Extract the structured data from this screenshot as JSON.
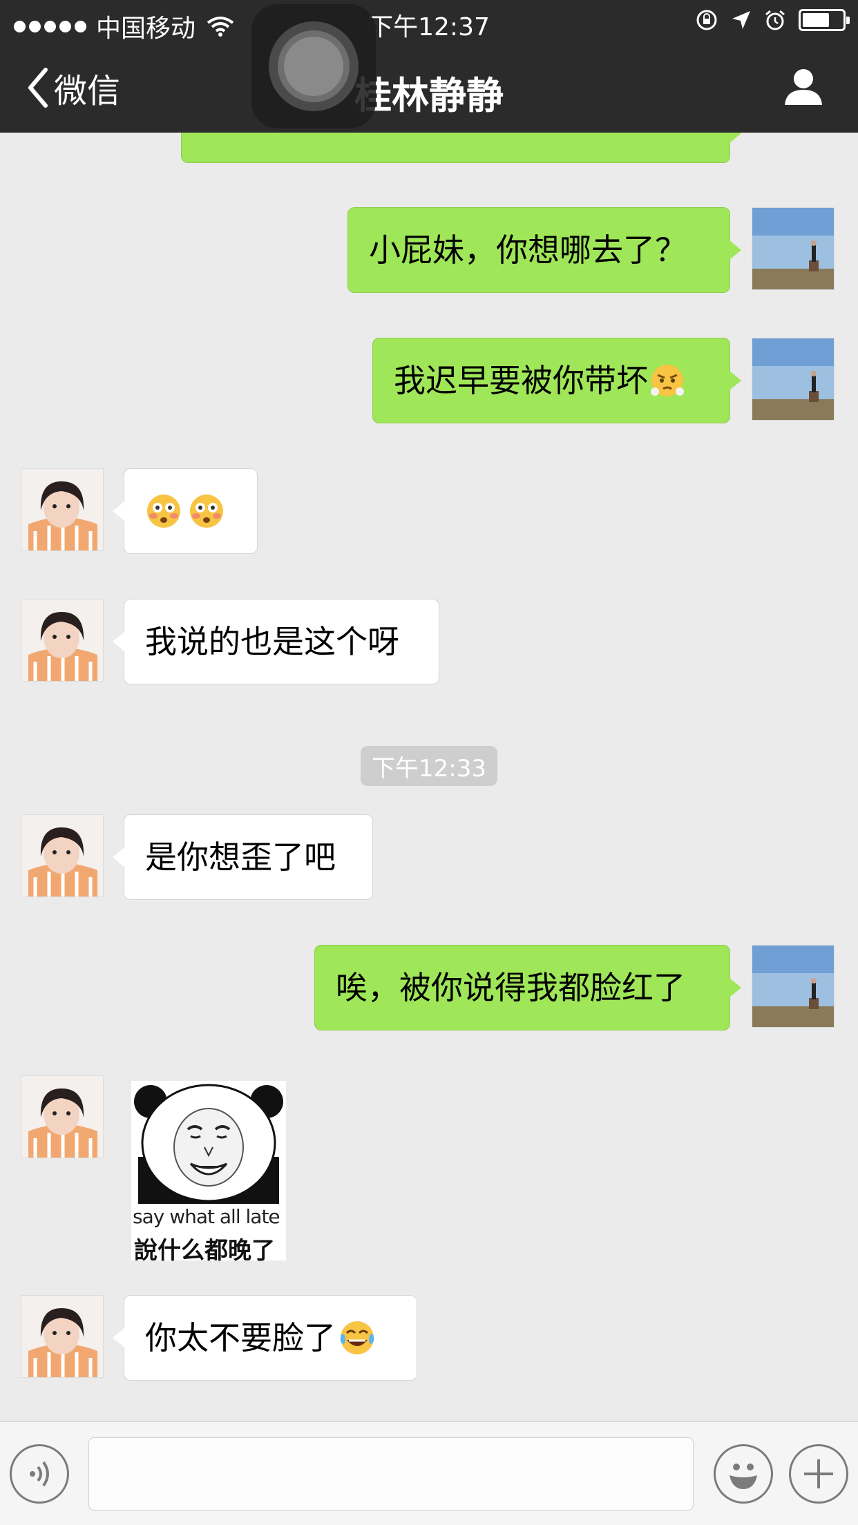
{
  "status_bar": {
    "carrier": "中国移动",
    "time": "下午12:37"
  },
  "nav": {
    "back_label": "微信",
    "title": "桂林静静"
  },
  "messages": [
    {
      "id": "m1",
      "side": "out",
      "text": "小屁妹，你想哪去了？"
    },
    {
      "id": "m2",
      "side": "out",
      "text": "我迟早要被你带坏",
      "emoji": "face-with-steam-from-nose"
    },
    {
      "id": "m3",
      "side": "in",
      "emojis": [
        "flushed-face",
        "flushed-face"
      ]
    },
    {
      "id": "m4",
      "side": "in",
      "text": "我说的也是这个呀"
    },
    {
      "id": "m5",
      "side": "in",
      "text": "是你想歪了吧"
    },
    {
      "id": "m6",
      "side": "out",
      "text": "唉，被你说得我都脸红了"
    },
    {
      "id": "m7",
      "side": "in",
      "sticker": {
        "caption_en": "say what all  late",
        "caption_zh": "說什么都晚了"
      }
    },
    {
      "id": "m8",
      "side": "in",
      "text": "你太不要脸了",
      "emoji": "tears-of-joy"
    }
  ],
  "timestamp_divider": "下午12:33",
  "colors": {
    "outgoing_bubble": "#9fe658",
    "incoming_bubble": "#ffffff",
    "background": "#ebebeb",
    "navbar": "#2b2b2b"
  },
  "input_bar": {
    "voice_icon": "voice-icon",
    "emoji_icon": "smiley-icon",
    "plus_icon": "plus-icon"
  }
}
